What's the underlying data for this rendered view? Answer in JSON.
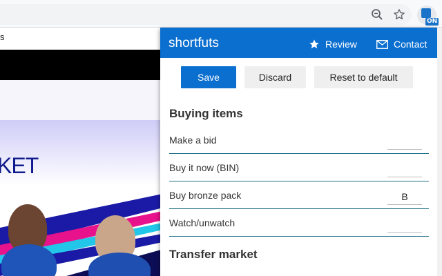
{
  "browser": {
    "extension_badge": "ON"
  },
  "site": {
    "partial_text": "s",
    "hero_title": "KET"
  },
  "popup": {
    "title": "shortfuts",
    "header_links": {
      "review": "Review",
      "contact": "Contact"
    },
    "buttons": {
      "save": "Save",
      "discard": "Discard",
      "reset": "Reset to default"
    },
    "sections": [
      {
        "title": "Buying items",
        "rows": [
          {
            "label": "Make a bid",
            "value": ""
          },
          {
            "label": "Buy it now (BIN)",
            "value": ""
          },
          {
            "label": "Buy bronze pack",
            "value": "B"
          },
          {
            "label": "Watch/unwatch",
            "value": ""
          }
        ]
      },
      {
        "title": "Transfer market",
        "rows": []
      }
    ],
    "accent_color": "#0b6fd0"
  }
}
